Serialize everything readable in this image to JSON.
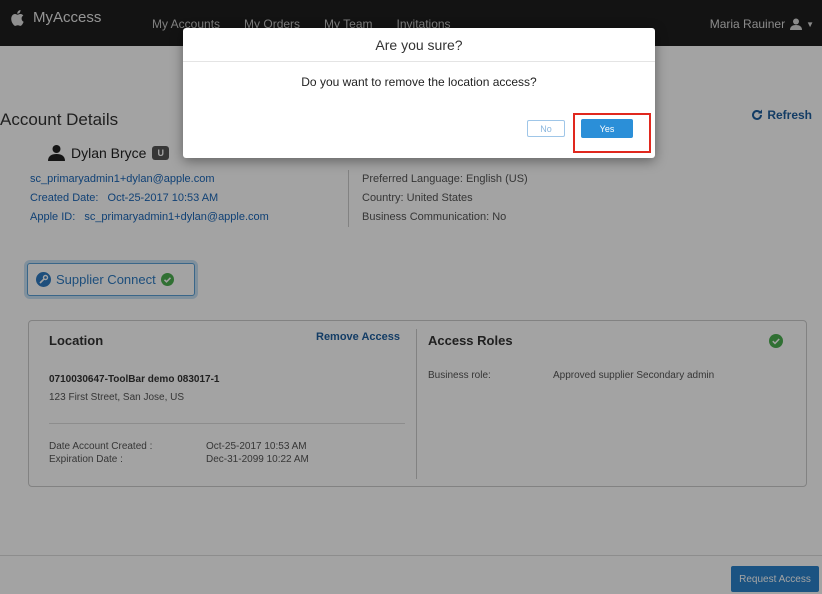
{
  "navbar": {
    "brand": "MyAccess",
    "links": [
      "My Accounts",
      "My Orders",
      "My Team",
      "Invitations"
    ],
    "user": "Maria Rauiner"
  },
  "page": {
    "title": "Account Details",
    "refresh_label": "Refresh"
  },
  "profile": {
    "name": "Dylan Bryce",
    "badge": "U",
    "email": "sc_primaryadmin1+dylan@apple.com",
    "created_label": "Created Date:",
    "created_value": "Oct-25-2017 10:53 AM",
    "apple_id_label": "Apple ID:",
    "apple_id_value": "sc_primaryadmin1+dylan@apple.com",
    "language": "Preferred Language: English (US)",
    "country": "Country: United States",
    "business_comm": "Business Communication: No"
  },
  "supplier_connect": {
    "label": "Supplier Connect"
  },
  "location_card": {
    "title": "Location",
    "remove_access": "Remove Access",
    "location_name": "0710030647-ToolBar demo 083017-1",
    "address": "123 First Street, San Jose, US",
    "date_created_label": "Date Account Created :",
    "date_created_value": "Oct-25-2017 10:53 AM",
    "expiration_label": "Expiration Date :",
    "expiration_value": "Dec-31-2099 10:22 AM"
  },
  "roles_card": {
    "title": "Access Roles",
    "business_role_label": "Business role:",
    "business_role_value": "Approved supplier Secondary admin"
  },
  "footer": {
    "request_access": "Request Access"
  },
  "modal": {
    "title": "Are you sure?",
    "message": "Do you want to remove the location access?",
    "no_label": "No",
    "yes_label": "Yes"
  },
  "colors": {
    "link_blue": "#1a66b8",
    "primary_button": "#2b8fd8",
    "highlight_red": "#e0281e",
    "success_green": "#4caf50"
  }
}
